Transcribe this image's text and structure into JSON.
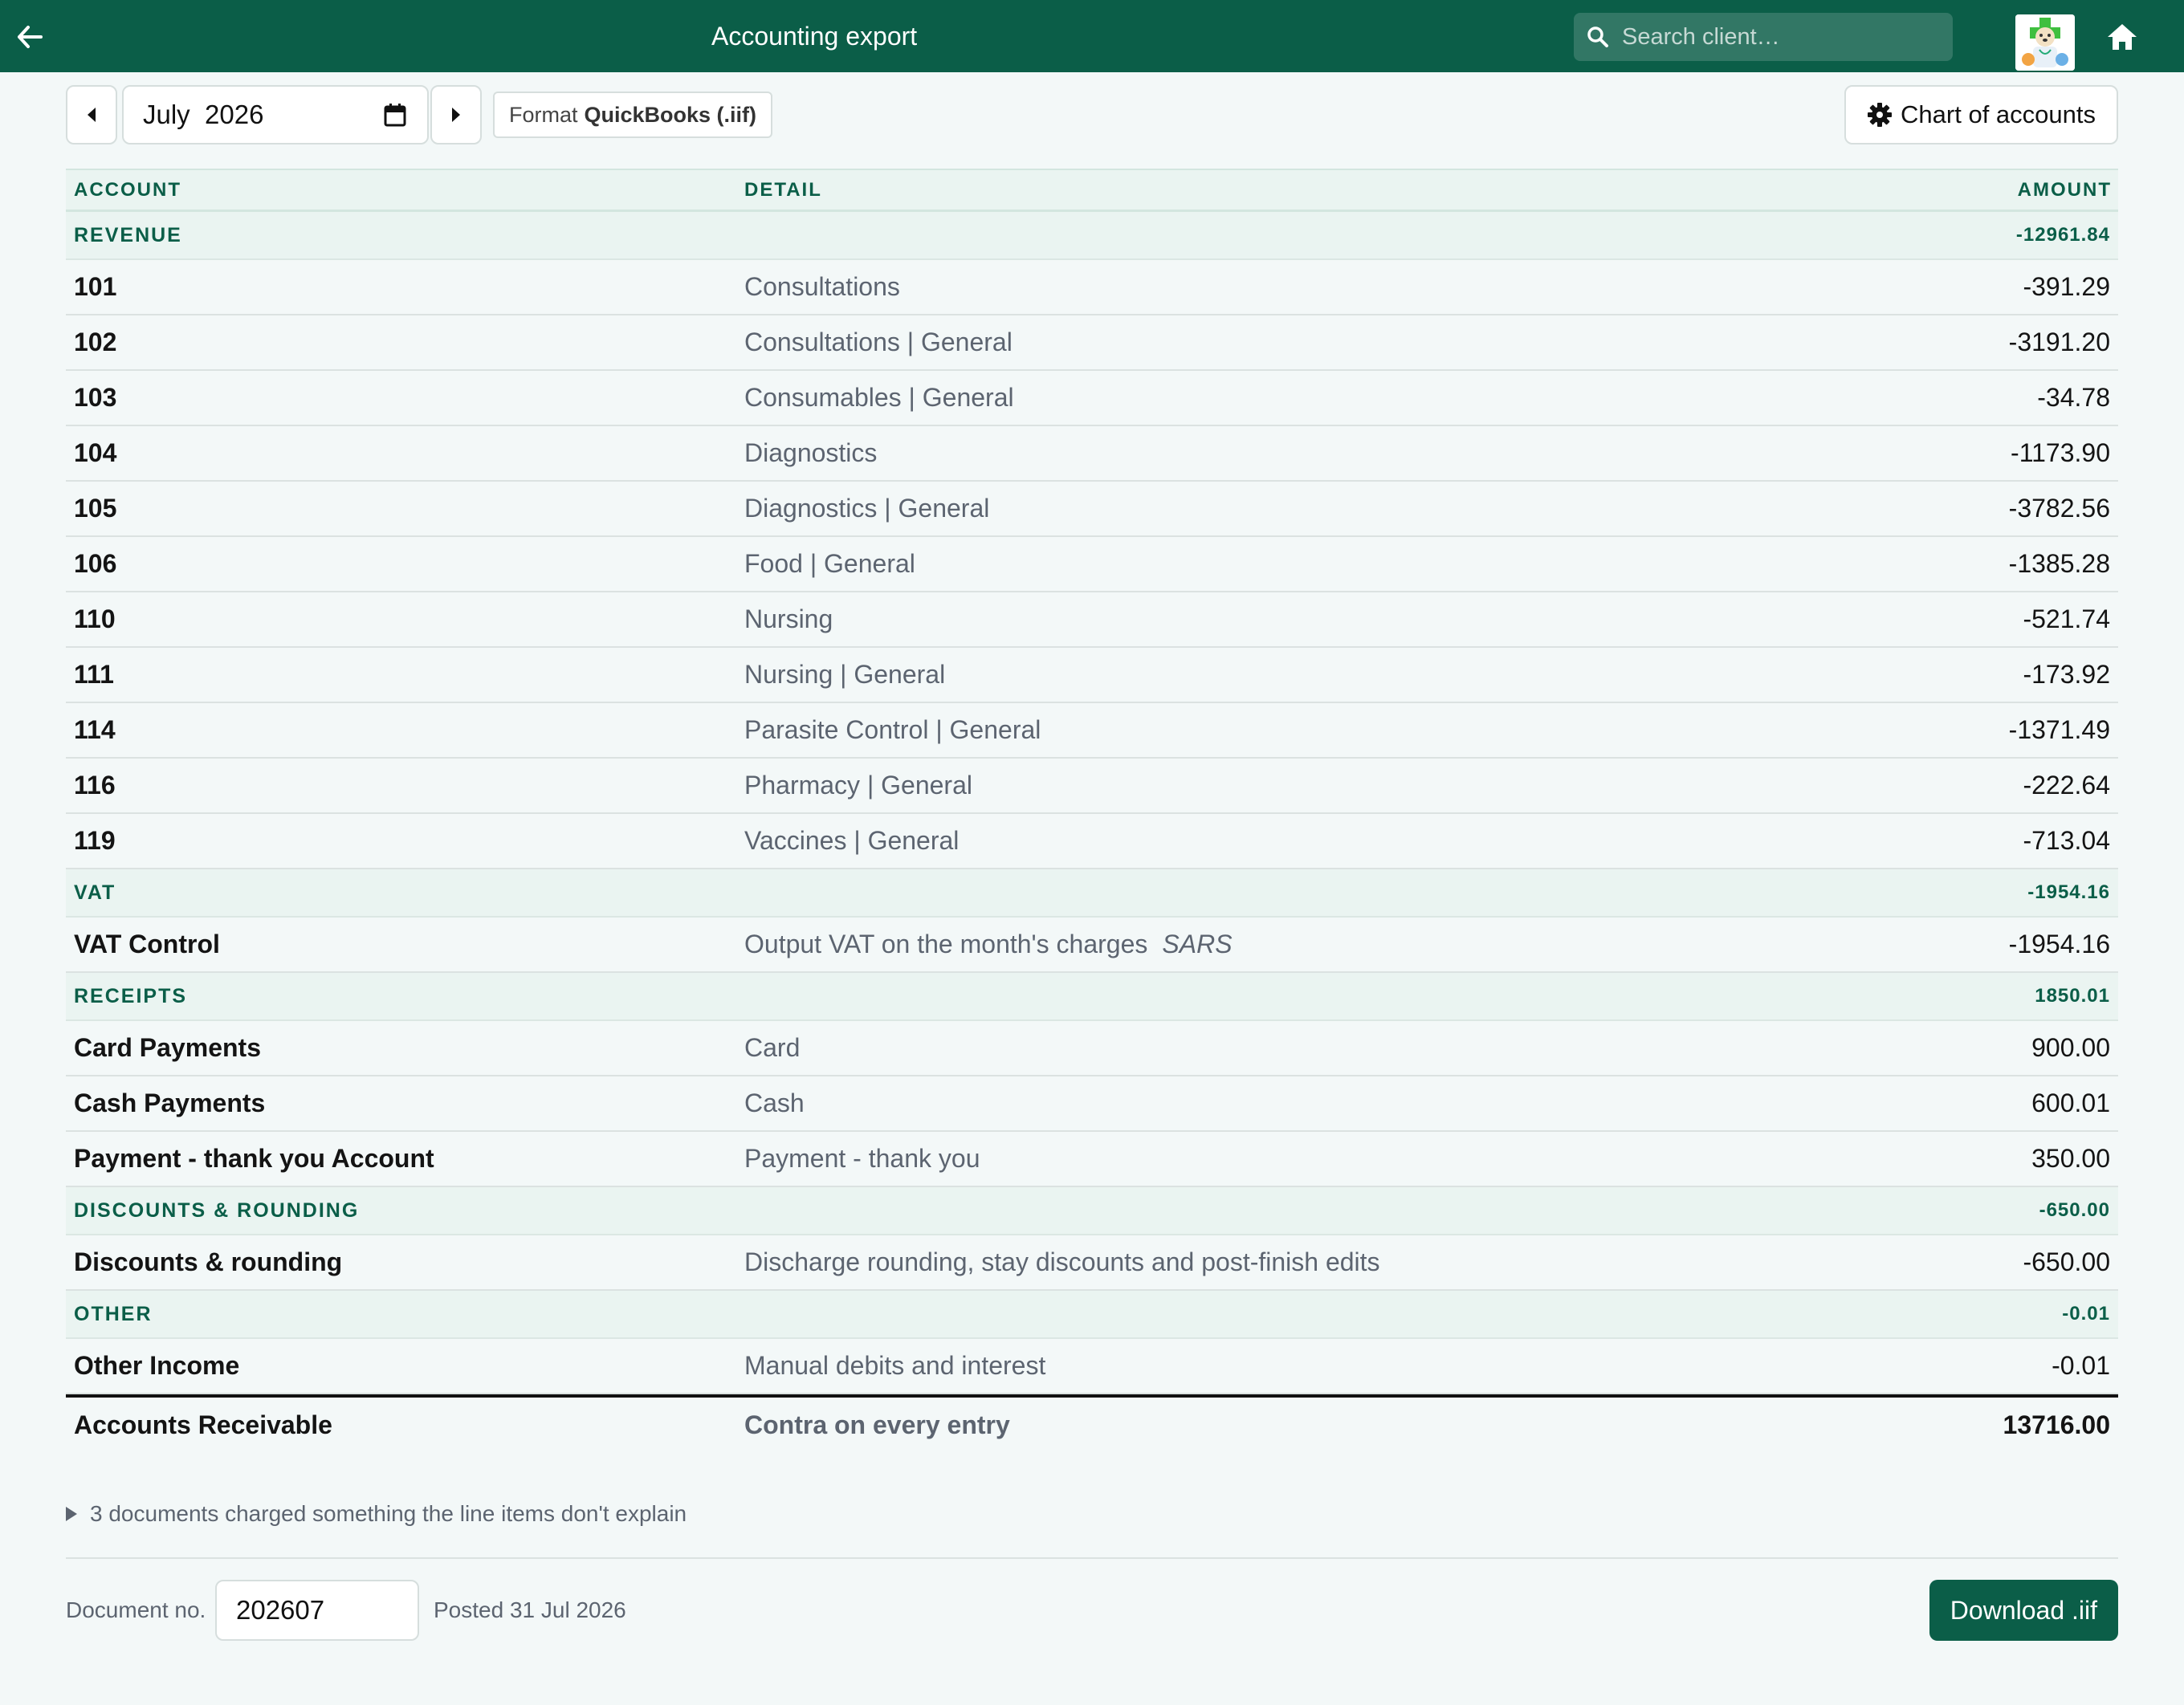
{
  "header": {
    "title": "Accounting export",
    "search_placeholder": "Search client…",
    "back_icon": "arrow-left-icon",
    "home_icon": "home-icon",
    "brand_color": "#0b5e48"
  },
  "toolbar": {
    "month_value": "July  2026",
    "format_label": "Format",
    "format_value": "QuickBooks (.iif)",
    "chart_of_accounts_label": "Chart of accounts"
  },
  "table": {
    "columns": {
      "account": "ACCOUNT",
      "detail": "DETAIL",
      "amount": "AMOUNT"
    },
    "sections": [
      {
        "name": "REVENUE",
        "total": "-12961.84",
        "rows": [
          {
            "account": "101",
            "detail": "Consultations",
            "amount": "-391.29"
          },
          {
            "account": "102",
            "detail": "Consultations | General",
            "amount": "-3191.20"
          },
          {
            "account": "103",
            "detail": "Consumables | General",
            "amount": "-34.78"
          },
          {
            "account": "104",
            "detail": "Diagnostics",
            "amount": "-1173.90"
          },
          {
            "account": "105",
            "detail": "Diagnostics | General",
            "amount": "-3782.56"
          },
          {
            "account": "106",
            "detail": "Food | General",
            "amount": "-1385.28"
          },
          {
            "account": "110",
            "detail": "Nursing",
            "amount": "-521.74"
          },
          {
            "account": "111",
            "detail": "Nursing | General",
            "amount": "-173.92"
          },
          {
            "account": "114",
            "detail": "Parasite Control | General",
            "amount": "-1371.49"
          },
          {
            "account": "116",
            "detail": "Pharmacy | General",
            "amount": "-222.64"
          },
          {
            "account": "119",
            "detail": "Vaccines | General",
            "amount": "-713.04"
          }
        ]
      },
      {
        "name": "VAT",
        "total": "-1954.16",
        "rows": [
          {
            "account": "VAT Control",
            "detail": "Output VAT on the month's charges",
            "detail_note": "SARS",
            "amount": "-1954.16"
          }
        ]
      },
      {
        "name": "RECEIPTS",
        "total": "1850.01",
        "rows": [
          {
            "account": "Card Payments",
            "detail": "Card",
            "amount": "900.00"
          },
          {
            "account": "Cash Payments",
            "detail": "Cash",
            "amount": "600.01"
          },
          {
            "account": "Payment - thank you Account",
            "detail": "Payment - thank you",
            "amount": "350.00"
          }
        ]
      },
      {
        "name": "DISCOUNTS & ROUNDING",
        "total": "-650.00",
        "rows": [
          {
            "account": "Discounts & rounding",
            "detail": "Discharge rounding, stay discounts and post-finish edits",
            "amount": "-650.00"
          }
        ]
      },
      {
        "name": "OTHER",
        "total": "-0.01",
        "rows": [
          {
            "account": "Other Income",
            "detail": "Manual debits and interest",
            "amount": "-0.01"
          }
        ]
      }
    ],
    "total": {
      "account": "Accounts Receivable",
      "detail": "Contra on every entry",
      "amount": "13716.00"
    }
  },
  "disclosure": {
    "text": "3 documents charged something the line items don't explain"
  },
  "footer": {
    "document_no_label": "Document no.",
    "document_no_value": "202607",
    "posted_text": "Posted 31 Jul 2026",
    "download_label": "Download .iif"
  }
}
